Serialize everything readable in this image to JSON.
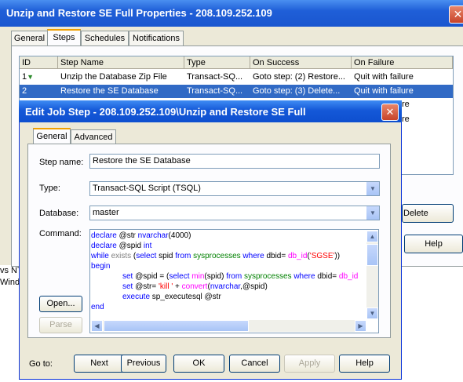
{
  "back_window": {
    "title": "Unzip and Restore SE Full Properties - 208.109.252.109",
    "close": "✕",
    "tabs": [
      "General",
      "Steps",
      "Schedules",
      "Notifications"
    ],
    "active_tab": "Steps",
    "grid": {
      "headers": [
        "ID",
        "Step Name",
        "Type",
        "On Success",
        "On Failure"
      ],
      "rows": [
        {
          "id": "1",
          "name": "Unzip the Database Zip File",
          "type": "Transact-SQ...",
          "success": "Goto step:  (2) Restore...",
          "failure": "Quit with failure",
          "selected": false
        },
        {
          "id": "2",
          "name": "Restore the SE Database",
          "type": "Transact-SQ...",
          "success": "Goto step:  (3) Delete...",
          "failure": "Quit with failure",
          "selected": true
        }
      ],
      "hidden_fragments": [
        "re",
        "re"
      ]
    },
    "delete_label": "Delete",
    "help_label": "Help"
  },
  "background_fragments": [
    "vs NT",
    "Wind"
  ],
  "dialog": {
    "title": "Edit Job Step - 208.109.252.109\\Unzip and Restore SE Full",
    "close": "✕",
    "tabs": [
      "General",
      "Advanced"
    ],
    "active_tab": "General",
    "step_name_label": "Step name:",
    "step_name_value": "Restore the SE Database",
    "type_label": "Type:",
    "type_value": "Transact-SQL Script (TSQL)",
    "database_label": "Database:",
    "database_value": "master",
    "command_label": "Command:",
    "command_lines": [
      "declare @str nvarchar(4000)",
      "declare @spid int",
      "while exists (select spid from sysprocesses where dbid= db_id('SGSE'))",
      "begin",
      "set @spid = (select min(spid) from sysprocesses where dbid= db_id",
      "set @str= 'kill ' + convert(nvarchar,@spid)",
      "execute sp_executesql @str",
      "end"
    ],
    "open_label": "Open...",
    "parse_label": "Parse",
    "goto_label": "Go to:",
    "buttons": {
      "next": "Next",
      "previous": "Previous",
      "ok": "OK",
      "cancel": "Cancel",
      "apply": "Apply",
      "help": "Help"
    }
  }
}
